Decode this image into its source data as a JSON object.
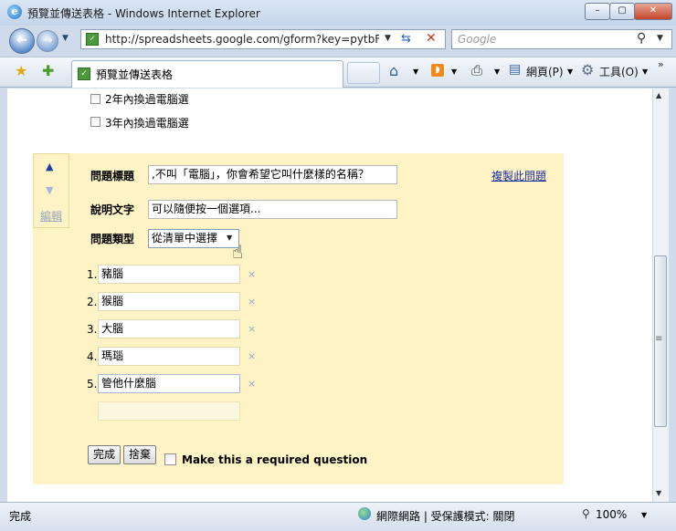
{
  "window": {
    "title": "預覽並傳送表格 - Windows Internet Explorer",
    "minimize": "–",
    "maximize": "▢",
    "close": "✕"
  },
  "nav": {
    "url": "http://spreadsheets.google.com/gform?key=pytbFzE",
    "search_placeholder": "Google"
  },
  "tab": {
    "label": "預覽並傳送表格"
  },
  "commandbar": {
    "page_label": "網頁(P)",
    "tools_label": "工具(O)"
  },
  "content": {
    "options_above": [
      "2年內換過電腦選",
      "3年內換過電腦選"
    ],
    "editor": {
      "move_up": "▲",
      "move_down": "▼",
      "edit_link": "編輯",
      "question_title_label": "問題標題",
      "question_title_value": ",不叫「電腦」，你會希望它叫什麼樣的名稱？",
      "copy_link": "複製此問題",
      "help_text_label": "說明文字",
      "help_text_value": "可以隨便按一個選項...",
      "question_type_label": "問題類型",
      "question_type_value": "從清單中選擇",
      "choices": [
        {
          "num": "1.",
          "value": "豬腦"
        },
        {
          "num": "2.",
          "value": "猴腦"
        },
        {
          "num": "3.",
          "value": "大腦"
        },
        {
          "num": "4.",
          "value": "瑪瑙"
        },
        {
          "num": "5.",
          "value": "管他什麼腦"
        }
      ],
      "remove_mark": "×",
      "done_button": "完成",
      "discard_button": "捨棄",
      "required_label": "Make this a required question"
    }
  },
  "status": {
    "left": "完成",
    "zone": "網際網路 | 受保護模式: 關閉",
    "zoom": "100%"
  }
}
